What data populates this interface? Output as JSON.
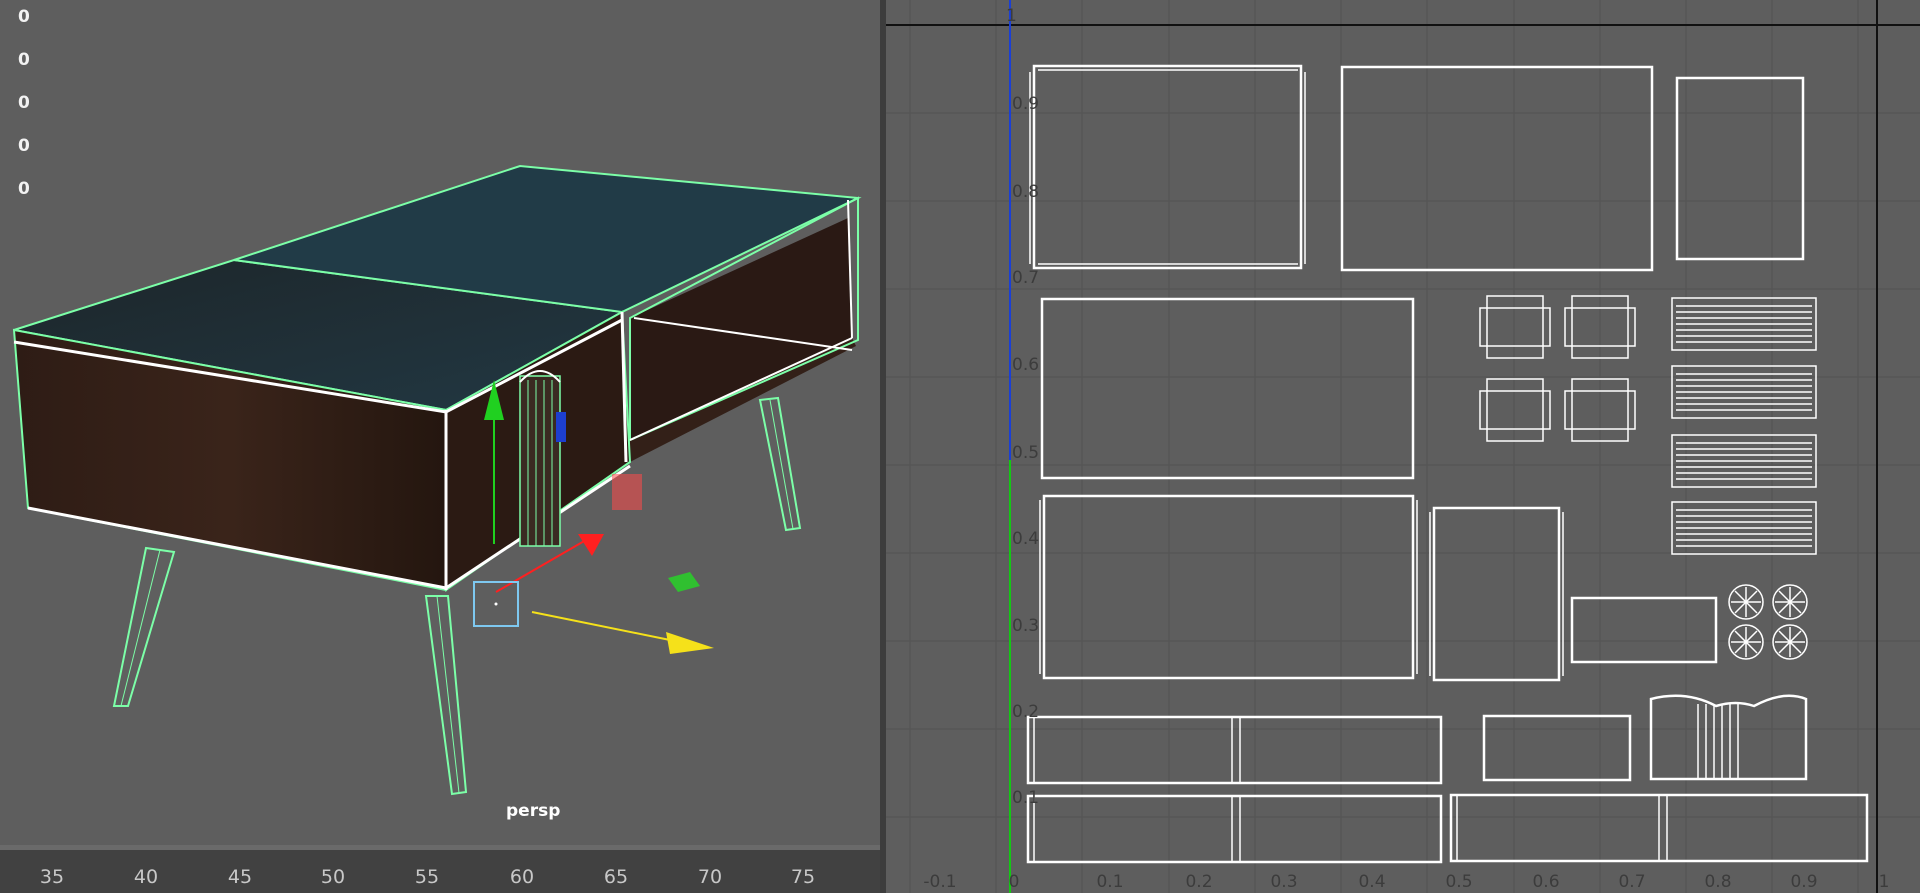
{
  "viewport": {
    "hud_values": [
      "0",
      "0",
      "0",
      "0",
      "0"
    ],
    "camera_label": "persp",
    "colors": {
      "selection_wire": "#7cffa8",
      "edge_white": "#ffffff",
      "wood_dark": "#2a1a14",
      "top_panel": "#1f3038",
      "move_x": "#ff2020",
      "move_y": "#20d020",
      "move_z": "#f5e11a",
      "pivot_box": "#7ec8f0"
    }
  },
  "timeline": {
    "ticks": [
      "35",
      "40",
      "45",
      "50",
      "55",
      "60",
      "65",
      "70",
      "75"
    ]
  },
  "uv_editor": {
    "v_axis_labels": [
      "1",
      "0.9",
      "0.8",
      "0.7",
      "0.6",
      "0.5",
      "0.4",
      "0.3",
      "0.2",
      "0.1"
    ],
    "u_axis_labels": [
      "-0.1",
      "0",
      "0.1",
      "0.2",
      "0.3",
      "0.4",
      "0.5",
      "0.6",
      "0.7",
      "0.8",
      "0.9",
      "1"
    ],
    "colors": {
      "grid": "#535353",
      "border": "#111111",
      "v_axis": "#1a3fd6",
      "u_axis": "#14c814",
      "uv_shell": "#ffffff"
    }
  }
}
